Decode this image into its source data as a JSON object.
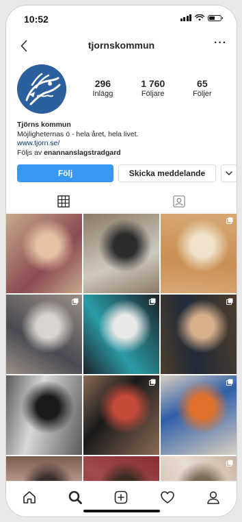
{
  "status_bar": {
    "time": "10:52"
  },
  "header": {
    "username": "tjornskommun"
  },
  "profile": {
    "stats": [
      {
        "value": "296",
        "label": "Inlägg"
      },
      {
        "value": "1 760",
        "label": "Följare"
      },
      {
        "value": "65",
        "label": "Följer"
      }
    ],
    "name": "Tjörns kommun",
    "bio": "Möjligheternas ö - hela året, hela livet.",
    "link": "www.tjorn.se/",
    "followed_by_prefix": "Följs av ",
    "followed_by_user": "enannanslagstradgard"
  },
  "actions": {
    "follow_label": "Följ",
    "message_label": "Skicka meddelande"
  },
  "tabs": [
    {
      "icon": "grid-icon",
      "active": true
    },
    {
      "icon": "tagged-icon",
      "active": false
    }
  ],
  "grid": [
    {
      "desc": "Woman with blonde hair holding pink cloth",
      "colors": [
        "#c9a98c",
        "#8a4a52",
        "#e6c1a3"
      ],
      "multi": false
    },
    {
      "desc": "Floor cleaning machine on wooden floor",
      "colors": [
        "#8a7a66",
        "#cfc9bd",
        "#2b2b2b"
      ],
      "multi": false
    },
    {
      "desc": "Empty room with wooden floor",
      "colors": [
        "#d6a874",
        "#c99055",
        "#f0e2c8"
      ],
      "multi": true
    },
    {
      "desc": "Cleaning trolley in storage room",
      "colors": [
        "#9a8f86",
        "#4a4a52",
        "#d9d4cf"
      ],
      "multi": true
    },
    {
      "desc": "Feather duster in front of wall clock",
      "colors": [
        "#1c2126",
        "#2a9ca8",
        "#e8e8e8"
      ],
      "multi": true
    },
    {
      "desc": "Smiling woman outdoors in autumn",
      "colors": [
        "#4e3d2b",
        "#1f2a3a",
        "#d8b08c"
      ],
      "multi": true
    },
    {
      "desc": "People in costumes black and white",
      "colors": [
        "#5a5a5a",
        "#d8d8d8",
        "#1a1a1a"
      ],
      "multi": false
    },
    {
      "desc": "People in costumes with hats",
      "colors": [
        "#8a6a55",
        "#1a1a1a",
        "#c44a3a"
      ],
      "multi": true
    },
    {
      "desc": "Classroom with colorful trays",
      "colors": [
        "#d9d0c2",
        "#2f5fa8",
        "#e0722e"
      ],
      "multi": true
    },
    {
      "desc": "People by doorway",
      "colors": [
        "#7a5b4c",
        "#c9a59a",
        "#3a2f2c"
      ],
      "multi": false
    },
    {
      "desc": "Table with baskets",
      "colors": [
        "#8a2d30",
        "#a04a4a",
        "#3a2c22"
      ],
      "multi": false
    },
    {
      "desc": "Room interior",
      "colors": [
        "#c8b2a0",
        "#e8dcd0",
        "#7a6a5a"
      ],
      "multi": true
    }
  ],
  "bottom_nav": [
    {
      "name": "home-icon"
    },
    {
      "name": "search-icon",
      "active": true
    },
    {
      "name": "new-post-icon"
    },
    {
      "name": "activity-icon"
    },
    {
      "name": "profile-icon"
    }
  ],
  "accent_color": "#3897f0"
}
